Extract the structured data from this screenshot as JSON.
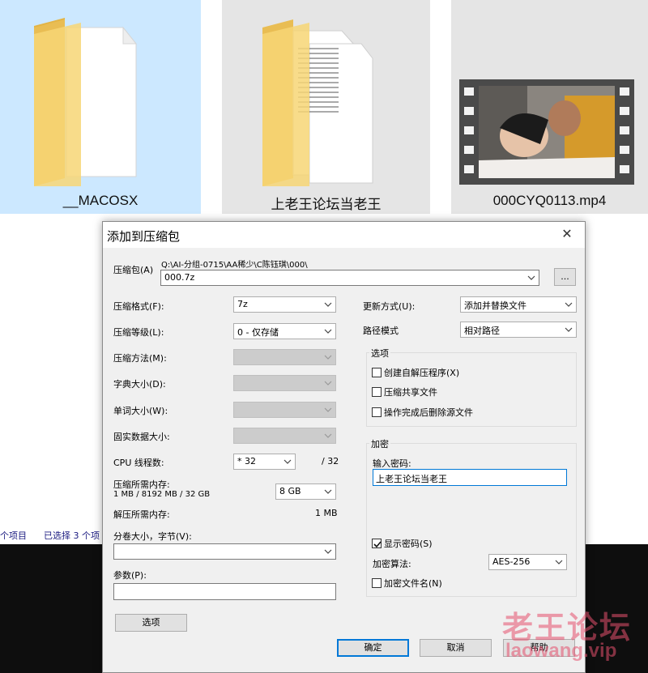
{
  "explorer": {
    "items": [
      {
        "label": "__MACOSX",
        "icon": "folder-icon"
      },
      {
        "label": "上老王论坛当老王",
        "icon": "folder-icon"
      },
      {
        "label": "000CYQ0113.mp4",
        "icon": "video-thumbnail"
      }
    ],
    "status": {
      "count": "个项目",
      "selected": "已选择 3 个项"
    }
  },
  "dialog": {
    "title": "添加到压缩包",
    "close": "✕",
    "archive": {
      "label": "压缩包(A)",
      "path": "Q:\\AI-分组-0715\\AA稀少\\C陈钰琪\\000\\",
      "value": "000.7z",
      "browse": "..."
    },
    "format": {
      "label": "压缩格式(F):",
      "value": "7z"
    },
    "level": {
      "label": "压缩等级(L):",
      "value": "0 - 仅存储"
    },
    "method": {
      "label": "压缩方法(M):"
    },
    "dict": {
      "label": "字典大小(D):"
    },
    "word": {
      "label": "单词大小(W):"
    },
    "solid": {
      "label": "固实数据大小:"
    },
    "threads": {
      "label": "CPU 线程数:",
      "value": "* 32",
      "max": "/ 32"
    },
    "mem": {
      "label": "压缩所需内存:",
      "detail": "1 MB / 8192 MB / 32 GB",
      "value": "8 GB"
    },
    "decomp": {
      "label": "解压所需内存:",
      "value": "1 MB"
    },
    "split": {
      "label": "分卷大小，字节(V):",
      "value": ""
    },
    "params": {
      "label": "参数(P):",
      "value": ""
    },
    "options_btn": "选项",
    "update": {
      "label": "更新方式(U):",
      "value": "添加并替换文件"
    },
    "path_mode": {
      "label": "路径模式",
      "value": "相对路径"
    },
    "options_group": {
      "title": "选项",
      "items": [
        {
          "label": "创建自解压程序(X)",
          "checked": false
        },
        {
          "label": "压缩共享文件",
          "checked": false
        },
        {
          "label": "操作完成后删除源文件",
          "checked": false
        }
      ]
    },
    "encryption": {
      "title": "加密",
      "pw_label": "输入密码:",
      "pw_value": "上老王论坛当老王",
      "show_pw": "显示密码(S)",
      "show_pw_checked": true,
      "algo_label": "加密算法:",
      "algo_value": "AES-256",
      "encrypt_names": "加密文件名(N)",
      "encrypt_names_checked": false
    },
    "buttons": {
      "ok": "确定",
      "cancel": "取消",
      "help": "帮助"
    }
  },
  "watermark": {
    "text": "老王论坛",
    "url": "laowang.vip"
  },
  "colors": {
    "selection": "#cce8ff",
    "dialog_bg": "#f0f0f0",
    "default_button_border": "#0078d7"
  }
}
